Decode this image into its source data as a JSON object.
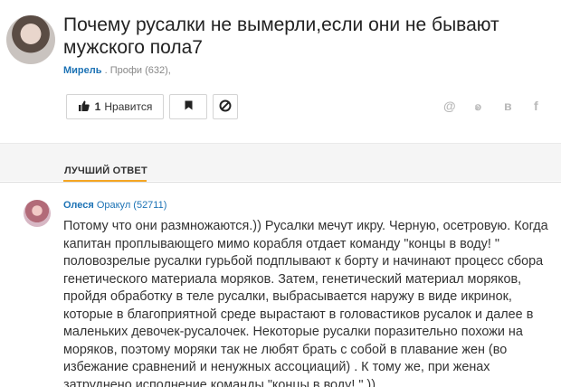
{
  "question": {
    "title": "Почему русалки не вымерли,если они не бывают мужского пола7",
    "author": "Мирель",
    "author_meta": ". Профи (632),"
  },
  "actions": {
    "like_count": "1",
    "like_label": "Нравится"
  },
  "share": {
    "at": "@",
    "ok": "ꭷ",
    "vk": "в",
    "fb": "f"
  },
  "best_answer": {
    "tab_label": "ЛУЧШИЙ ОТВЕТ",
    "author": "Олеся",
    "rank": "Оракул (52711)",
    "text": "Потому что они размножаются.)) Русалки мечут икру. Черную, осетровую. Когда капитан проплывающего мимо корабля отдает команду \"концы в воду! \" половозрелые русалки гурьбой подплывают к борту и начинают процесс сбора генетического материала моряков. Затем, генетический материал моряков, пройдя обработку в теле русалки, выбрасывается наружу в виде икринок, которые в благоприятной среде вырастают в головастиков русалок и далее в маленьких девочек-русалочек. Некоторые русалки поразительно похожи на моряков, поэтому моряки так не любят брать с собой в плавание жен (во избежание сравнений и ненужных ассоциаций) . К тому же, при женах затруднено исполнение команды \"концы в воду! \".))"
  }
}
